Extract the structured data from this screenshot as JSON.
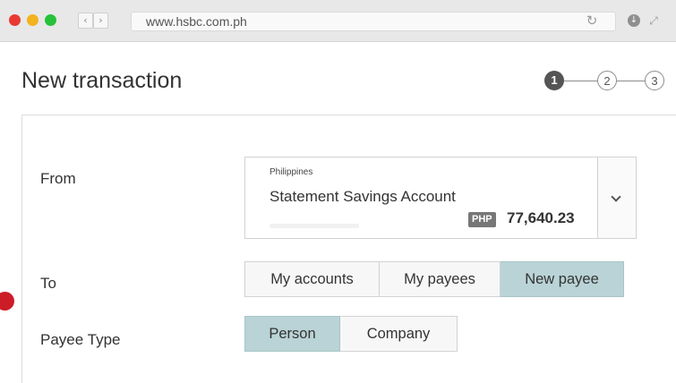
{
  "browser": {
    "url": "www.hsbc.com.ph",
    "icons": {
      "back": "chevron-left-icon",
      "forward": "chevron-right-icon",
      "reload": "reload-icon",
      "download": "download-icon",
      "expand": "expand-icon"
    }
  },
  "page": {
    "title": "New transaction",
    "steps": [
      "1",
      "2",
      "3"
    ],
    "active_step": 1
  },
  "form": {
    "from": {
      "label": "From",
      "country": "Philippines",
      "account_name": "Statement Savings Account",
      "currency": "PHP",
      "balance": "77,640.23"
    },
    "to": {
      "label": "To",
      "options": [
        "My accounts",
        "My payees",
        "New payee"
      ],
      "selected": "New payee"
    },
    "payee_type": {
      "label": "Payee Type",
      "options": [
        "Person",
        "Company"
      ],
      "selected": "Person"
    }
  },
  "colors": {
    "selected_segment": "#b9d3d6",
    "marker": "#cc1c28",
    "step_active": "#555555"
  }
}
